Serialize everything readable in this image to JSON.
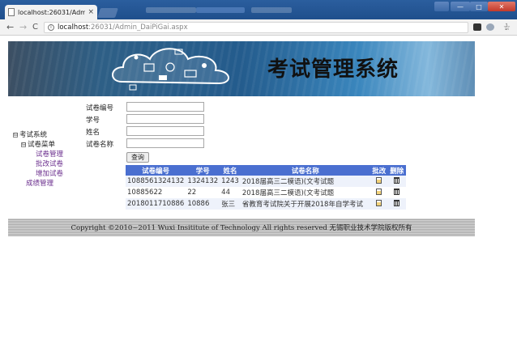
{
  "browser": {
    "tab_title": "localhost:26031/Admi",
    "tab_close": "×",
    "url_host": "localhost",
    "url_path": ":26031/Admin_DaiPiGai.aspx",
    "nav_back": "←",
    "nav_forward": "→",
    "nav_reload": "C",
    "info": "i",
    "star": "☆",
    "win_min": "—",
    "win_max": "□",
    "win_close": "✕"
  },
  "banner": {
    "title": "考试管理系统"
  },
  "tree": {
    "root_toggle": "⊟",
    "root_label": "考试系统",
    "menu_toggle": "⊟",
    "menu_label": "试卷菜单",
    "items": [
      "试卷管理",
      "批改试卷",
      "增加试卷"
    ],
    "grade_label": "成绩管理"
  },
  "form": {
    "labels": [
      "试卷编号",
      "学号",
      "姓名",
      "试卷名称"
    ],
    "values": [
      "",
      "",
      "",
      ""
    ],
    "query_label": "查询"
  },
  "table": {
    "headers": [
      "试卷编号",
      "学号",
      "姓名",
      "试卷名称",
      "批改",
      "删除"
    ],
    "rows": [
      [
        "1088561324132",
        "1324132",
        "1243",
        "2018届高三二模语)(文考试题"
      ],
      [
        "10885622",
        "22",
        "44",
        "2018届高三二模语)(文考试题"
      ],
      [
        "2018011710886",
        "10886",
        "张三",
        "省教育考试院关于开展2018年自学考试"
      ]
    ]
  },
  "footer": {
    "copyright": "Copyright ©2010~2011 Wuxi Insititute of Technology All rights reserved 无锡职业技术学院版权所有"
  },
  "colors": {
    "table_header": "#4a6fd0",
    "link_purple": "#6b2f8e",
    "titlebar": "#2b5e9e"
  }
}
